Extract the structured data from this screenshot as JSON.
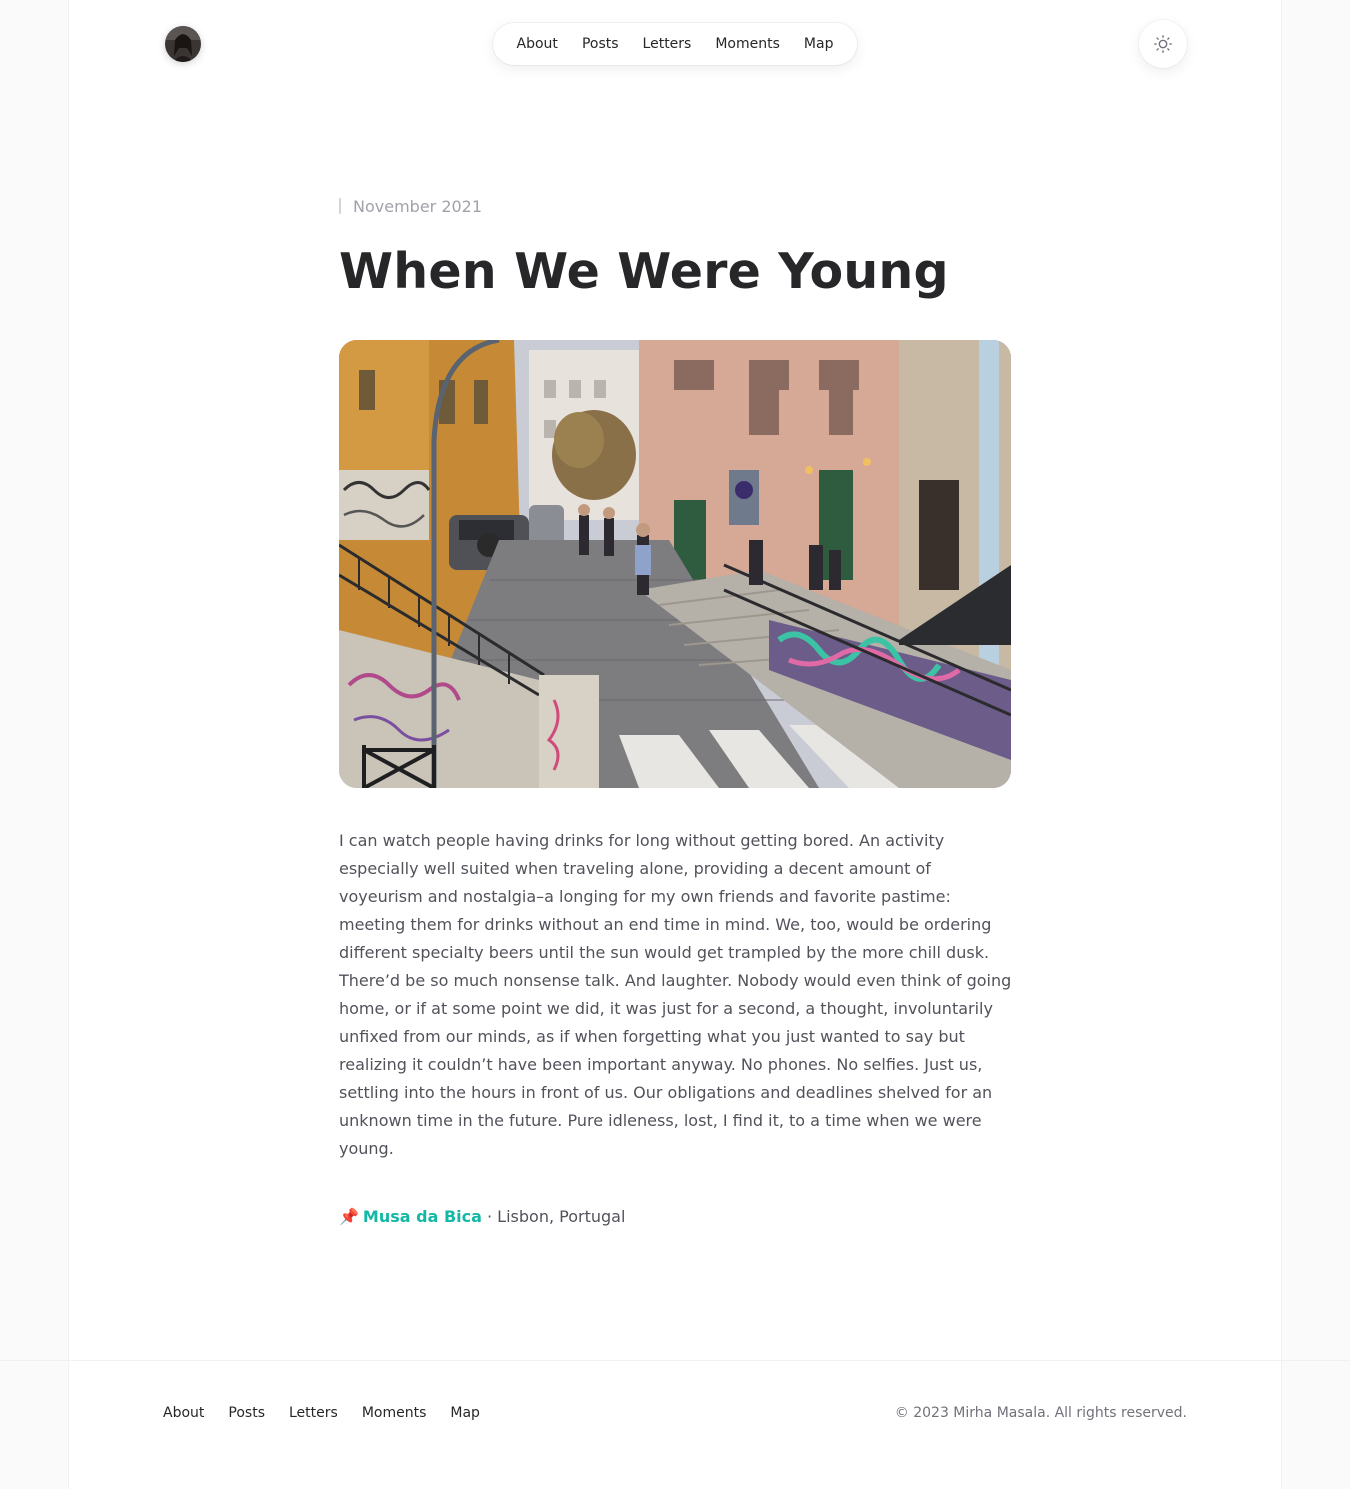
{
  "header": {
    "avatar_icon": "profile-photo",
    "nav": [
      {
        "label": "About"
      },
      {
        "label": "Posts"
      },
      {
        "label": "Letters"
      },
      {
        "label": "Moments"
      },
      {
        "label": "Map"
      }
    ],
    "theme_toggle_icon": "sun-icon"
  },
  "article": {
    "date": "November 2021",
    "title": "When We Were Young",
    "hero_image_subject": "sloped Lisbon street with stairs, railings, graffiti and people outside a bar",
    "body": "I can watch people having drinks for long without getting bored. An activity especially well suited when traveling alone, providing a decent amount of voyeurism and nostalgia–a longing for my own friends and favorite pastime: meeting them for drinks without an end time in mind. We, too, would be ordering different specialty beers until the sun would get trampled by the more chill dusk. There’d be so much nonsense talk. And laughter. Nobody would even think of going home, or if at some point we did, it was just for a second, a thought, involuntarily unfixed from our minds, as if when forgetting what you just wanted to say but realizing it couldn’t have been important anyway. No phones. No selfies. Just us, settling into the hours in front of us. Our obligations and deadlines shelved for an unknown time in the future. Pure idleness, lost, I find it, to a time when we were young.",
    "location": {
      "pin": "📌",
      "place": "Musa da Bica",
      "separator": " · ",
      "city": "Lisbon, Portugal"
    }
  },
  "footer": {
    "nav": [
      {
        "label": "About"
      },
      {
        "label": "Posts"
      },
      {
        "label": "Letters"
      },
      {
        "label": "Moments"
      },
      {
        "label": "Map"
      }
    ],
    "copyright": "© 2023 Mirha Masala. All rights reserved."
  },
  "colors": {
    "accent": "#14b8a6",
    "text": "#27272a",
    "muted": "#a1a1aa",
    "body_text": "#52525b",
    "page_bg": "#fafafa"
  }
}
